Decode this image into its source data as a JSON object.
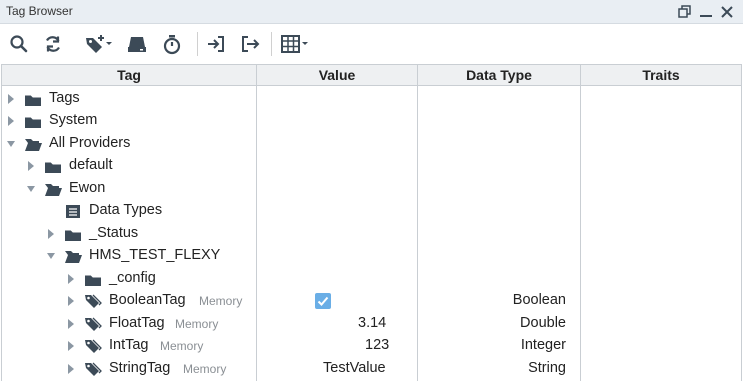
{
  "window": {
    "title": "Tag Browser"
  },
  "toolbar": {
    "buttons": [
      {
        "icon": "search-icon"
      },
      {
        "icon": "refresh-icon"
      },
      {
        "icon": "add-tag-dropdown-icon"
      },
      {
        "icon": "device-icon"
      },
      {
        "icon": "stopwatch-icon"
      },
      {
        "icon": "import-icon"
      },
      {
        "icon": "export-icon"
      },
      {
        "icon": "table-columns-dropdown-icon"
      }
    ]
  },
  "columns": {
    "tag": "Tag",
    "value": "Value",
    "data_type": "Data Type",
    "traits": "Traits"
  },
  "tree": {
    "rows": [
      {
        "label": "Tags",
        "expander": "collapsed",
        "icon": "folder-closed"
      },
      {
        "label": "System",
        "expander": "collapsed",
        "icon": "folder-closed"
      },
      {
        "label": "All Providers",
        "expander": "expanded",
        "icon": "folder-open"
      },
      {
        "label": "default",
        "expander": "collapsed",
        "icon": "folder-closed"
      },
      {
        "label": "Ewon",
        "expander": "expanded",
        "icon": "folder-open"
      },
      {
        "label": "Data Types",
        "expander": "none",
        "icon": "data-types"
      },
      {
        "label": "_Status",
        "expander": "collapsed",
        "icon": "folder-closed"
      },
      {
        "label": "HMS_TEST_FLEXY",
        "expander": "expanded",
        "icon": "folder-open"
      },
      {
        "label": "_config",
        "expander": "collapsed",
        "icon": "folder-closed"
      },
      {
        "label": "BooleanTag",
        "meta": "Memory",
        "expander": "collapsed",
        "icon": "tag",
        "value": "",
        "checked": true,
        "data_type": "Boolean"
      },
      {
        "label": "FloatTag",
        "meta": "Memory",
        "expander": "collapsed",
        "icon": "tag",
        "value": "3.14",
        "data_type": "Double"
      },
      {
        "label": "IntTag",
        "meta": "Memory",
        "expander": "collapsed",
        "icon": "tag",
        "value": "123",
        "data_type": "Integer"
      },
      {
        "label": "StringTag",
        "meta": "Memory",
        "expander": "collapsed",
        "icon": "tag",
        "value": "TestValue",
        "data_type": "String"
      }
    ]
  },
  "colors": {
    "icon": "#3c4a57",
    "header_bg": "#eef0f2",
    "checkbox": "#6aaee6"
  }
}
